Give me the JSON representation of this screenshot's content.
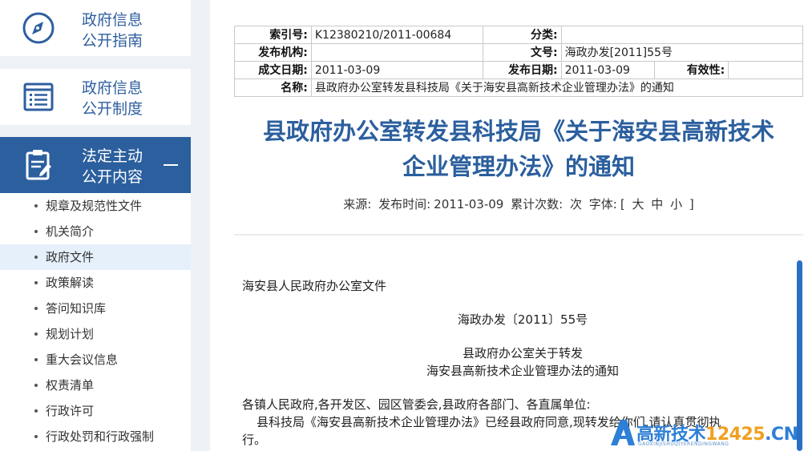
{
  "sidebar": {
    "cards": [
      {
        "line1": "政府信息",
        "line2": "公开指南",
        "icon": "compass-icon"
      },
      {
        "line1": "政府信息",
        "line2": "公开制度",
        "icon": "list-icon"
      },
      {
        "line1": "法定主动",
        "line2": "公开内容",
        "icon": "clipboard-edit-icon"
      }
    ],
    "items": [
      {
        "label": "规章及规范性文件"
      },
      {
        "label": "机关简介"
      },
      {
        "label": "政府文件"
      },
      {
        "label": "政策解读"
      },
      {
        "label": "答问知识库"
      },
      {
        "label": "规划计划"
      },
      {
        "label": "重大会议信息"
      },
      {
        "label": "权责清单"
      },
      {
        "label": "行政许可"
      },
      {
        "label": "行政处罚和行政强制"
      }
    ],
    "active_item": "政府文件"
  },
  "meta": {
    "index_label": "索引号:",
    "index_value": "K12380210/2011-00684",
    "category_label": "分类:",
    "category_value": "",
    "publisher_label": "发布机构:",
    "publisher_value": "",
    "docno_label": "文号:",
    "docno_value": "海政办发[2011]55号",
    "created_label": "成文日期:",
    "created_value": "2011-03-09",
    "published_label": "发布日期:",
    "published_value": "2011-03-09",
    "validity_label": "有效性:",
    "validity_value": "",
    "name_label": "名称:",
    "name_value": "县政府办公室转发县科技局《关于海安县高新技术企业管理办法》的通知"
  },
  "article": {
    "title_line1": "县政府办公室转发县科技局《关于海安县高新技术",
    "title_line2": "企业管理办法》的通知",
    "source_label": "来源:",
    "time_label": "发布时间:",
    "time_value": "2011-03-09",
    "views_label": "累计次数:",
    "views_suffix": "次",
    "font_label": "字体:",
    "font_open": "[",
    "font_large": "大",
    "font_medium": "中",
    "font_small": "小",
    "font_close": "]",
    "body": {
      "org": "海安县人民政府办公室文件",
      "docno": "海政办发〔2011〕55号",
      "heading1": "县政府办公室关于转发",
      "heading2": "海安县高新技术企业管理办法的通知",
      "recipients": "各镇人民政府,各开发区、园区管委会,县政府各部门、各直属单位:",
      "para1": "县科技局《海安县高新技术企业管理办法》已经县政府同意,现转发给你们,请认真贯彻执",
      "para1_end": "行。"
    }
  },
  "watermark": {
    "main": "高新技术",
    "num": "12425",
    "cn": ".CN",
    "sub": "GAOXINJISHUQIYERENDINGWANG"
  },
  "colors": {
    "brand": "#2b5f9e",
    "scrollbar": "#2b6fc4"
  }
}
